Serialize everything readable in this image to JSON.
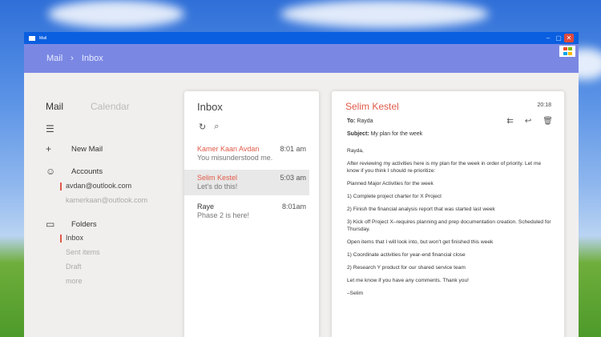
{
  "window": {
    "title": "Mail"
  },
  "header": {
    "crumb_root": "Mail",
    "crumb_current": "Inbox"
  },
  "sidebar": {
    "tab_mail": "Mail",
    "tab_calendar": "Calendar",
    "new_mail": "New Mail",
    "accounts": "Accounts",
    "account_items": [
      "avdan@outlook.com",
      "kamerkaan@outlook.com"
    ],
    "folders": "Folders",
    "folder_items": [
      "Inbox",
      "Sent items",
      "Draft",
      "more"
    ]
  },
  "inbox": {
    "title": "Inbox",
    "messages": [
      {
        "sender": "Kamer Kaan Avdan",
        "time": "8:01 am",
        "preview": "You misunderstood me."
      },
      {
        "sender": "Selim Kestel",
        "time": "5:03 am",
        "preview": "Let's do this!"
      },
      {
        "sender": "Raye",
        "time": "8:01am",
        "preview": "Phase 2 is here!"
      }
    ]
  },
  "reader": {
    "from": "Selim Kestel",
    "time": "20:18",
    "to_label": "To:",
    "to": "Rayda",
    "subject_label": "Subject:",
    "subject": "My plan for the week",
    "paragraphs": [
      "Rayda,",
      "After reviewing my activities here is my plan for the week in order of priority. Let me know if you think I should re-prioritize:",
      "Planned Major Activities for the week",
      "1) Complete project charter for X Project",
      "2) Finish the financial analysis report that was started last week",
      "3) Kick off Project X–requires planning and prep documentation creation. Scheduled for Thursday.",
      "Open items that I will look into, but won't get finished this week",
      "1) Coordinate activities for year-end financial close",
      "2) Research Y product for our shared service team",
      "Let me know if you have any comments. Thank you!",
      "–Selim"
    ]
  },
  "colors": {
    "accent": "#e05a48",
    "header": "#7b88e3",
    "titlebar": "#0a5fe0"
  }
}
